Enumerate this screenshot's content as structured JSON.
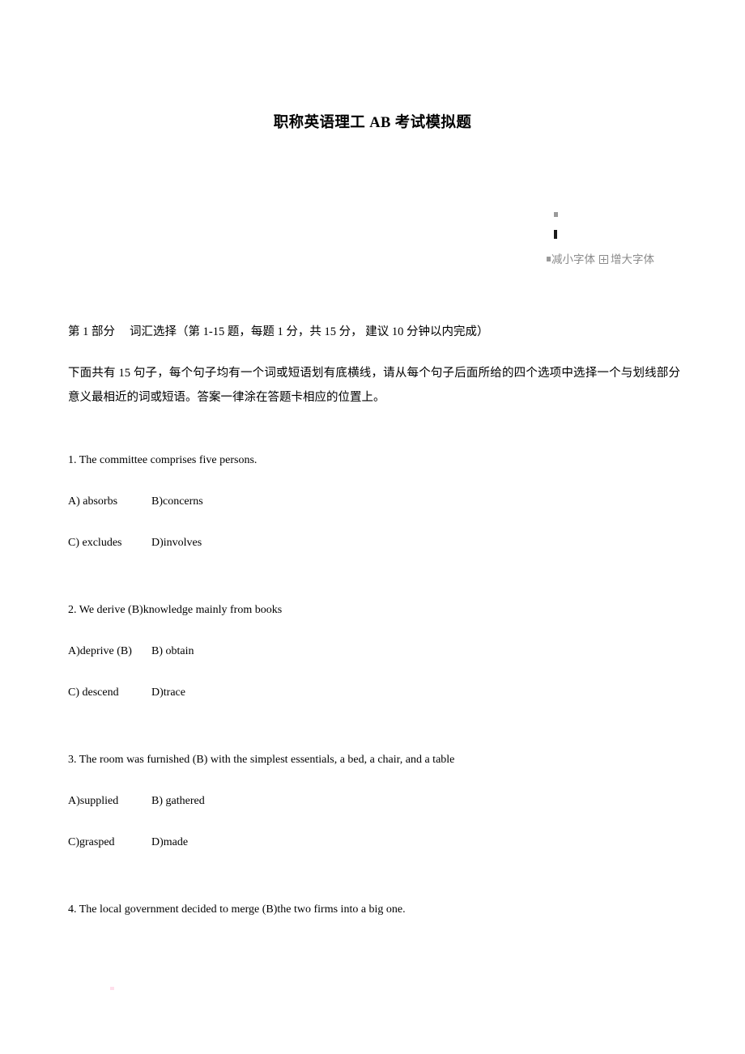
{
  "document": {
    "title": "职称英语理工 AB 考试模拟题"
  },
  "font_controls": {
    "decrease_label": "减小字体",
    "increase_label": "增大字体",
    "decrease_icon": "broken-image-icon",
    "increase_icon": "box-plus-icon",
    "text_color": "#8a8a8a"
  },
  "section": {
    "heading_part": "第 1 部分",
    "heading_title": "词汇选择（第 1-15 题，每题 1 分，共 15 分， 建议 10 分钟以内完成）",
    "instructions": "下面共有 15 句子，每个句子均有一个词或短语划有底横线，请从每个句子后面所给的四个选项中选择一个与划线部分意义最相近的词或短语。答案一律涂在答题卡相应的位置上。"
  },
  "questions": [
    {
      "stem": "1. The committee comprises five persons.",
      "row1_a": "A) absorbs",
      "row1_b": "B)concerns",
      "row2_c": "C) excludes",
      "row2_d": "D)involves"
    },
    {
      "stem": "2. We derive (B)knowledge mainly from books",
      "row1_a": "A)deprive (B)",
      "row1_b": "B) obtain",
      "row2_c": "C) descend",
      "row2_d": "D)trace"
    },
    {
      "stem": "3. The room was furnished (B) with the simplest essentials, a bed, a chair, and a table",
      "row1_a": "A)supplied",
      "row1_b": "B) gathered",
      "row2_c": "C)grasped",
      "row2_d": "D)made"
    },
    {
      "stem": "4. The local government decided to merge (B)the two firms into a big one.",
      "row1_a": "",
      "row1_b": "",
      "row2_c": "",
      "row2_d": ""
    }
  ]
}
